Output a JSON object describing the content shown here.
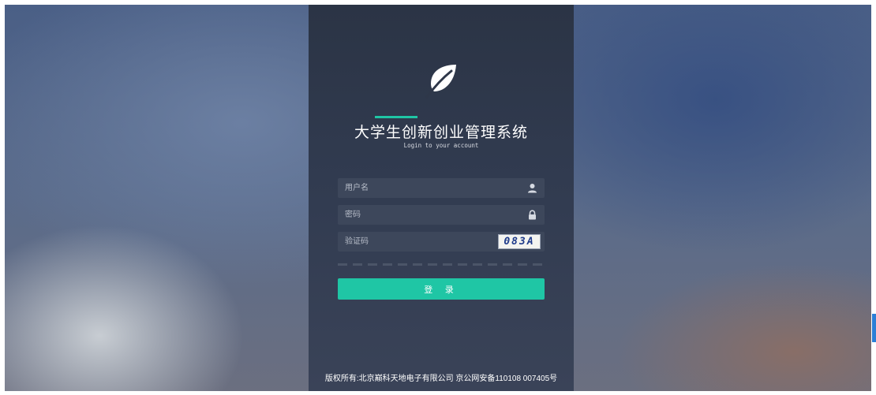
{
  "app": {
    "title": "大学生创新创业管理系统",
    "subtitle": "Login to your account"
  },
  "form": {
    "username_placeholder": "用户名",
    "password_placeholder": "密码",
    "captcha_placeholder": "验证码",
    "captcha_text": "083A",
    "login_label": "登 录"
  },
  "icons": {
    "logo": "leaf-icon",
    "username": "user-icon",
    "password": "lock-icon"
  },
  "colors": {
    "accent": "#1fc6a5",
    "panel": "#2e3749",
    "captcha_text": "#1e3a8a"
  },
  "footer": {
    "text": "版权所有:北京巅科天地电子有限公司 京公网安备110108 007405号"
  }
}
